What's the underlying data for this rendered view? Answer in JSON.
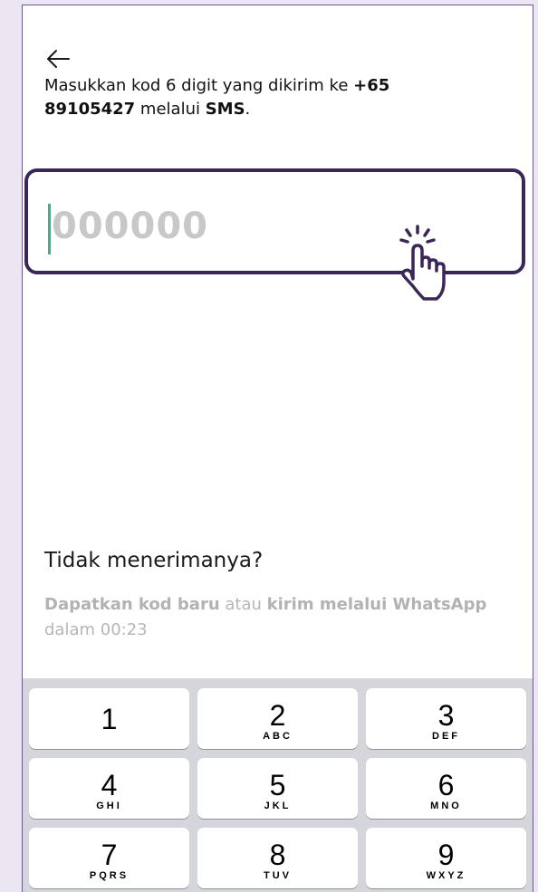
{
  "header": {
    "back_icon": "arrow-left-icon"
  },
  "instruction": {
    "prefix": "Masukkan kod 6 digit yang dikirim ke ",
    "phone": "+65 89105427",
    "middle": " melalui ",
    "channel": "SMS",
    "suffix": "."
  },
  "code_input": {
    "placeholder": "000000",
    "value": "",
    "caret_color": "#2eb886",
    "border_color": "#3a2757"
  },
  "tap_hint": {
    "icon": "tap-hand-icon",
    "color": "#3a2757"
  },
  "resend": {
    "title": "Tidak menerimanya?",
    "get_new_code": "Dapatkan kod baru",
    "or": " atau ",
    "whatsapp": "kirim melalui WhatsApp",
    "countdown_prefix": " dalam ",
    "countdown": "00:23"
  },
  "keypad": {
    "keys": [
      {
        "num": "1",
        "letters": ""
      },
      {
        "num": "2",
        "letters": "ABC"
      },
      {
        "num": "3",
        "letters": "DEF"
      },
      {
        "num": "4",
        "letters": "GHI"
      },
      {
        "num": "5",
        "letters": "JKL"
      },
      {
        "num": "6",
        "letters": "MNO"
      },
      {
        "num": "7",
        "letters": "PQRS"
      },
      {
        "num": "8",
        "letters": "TUV"
      },
      {
        "num": "9",
        "letters": "WXYZ"
      }
    ]
  }
}
